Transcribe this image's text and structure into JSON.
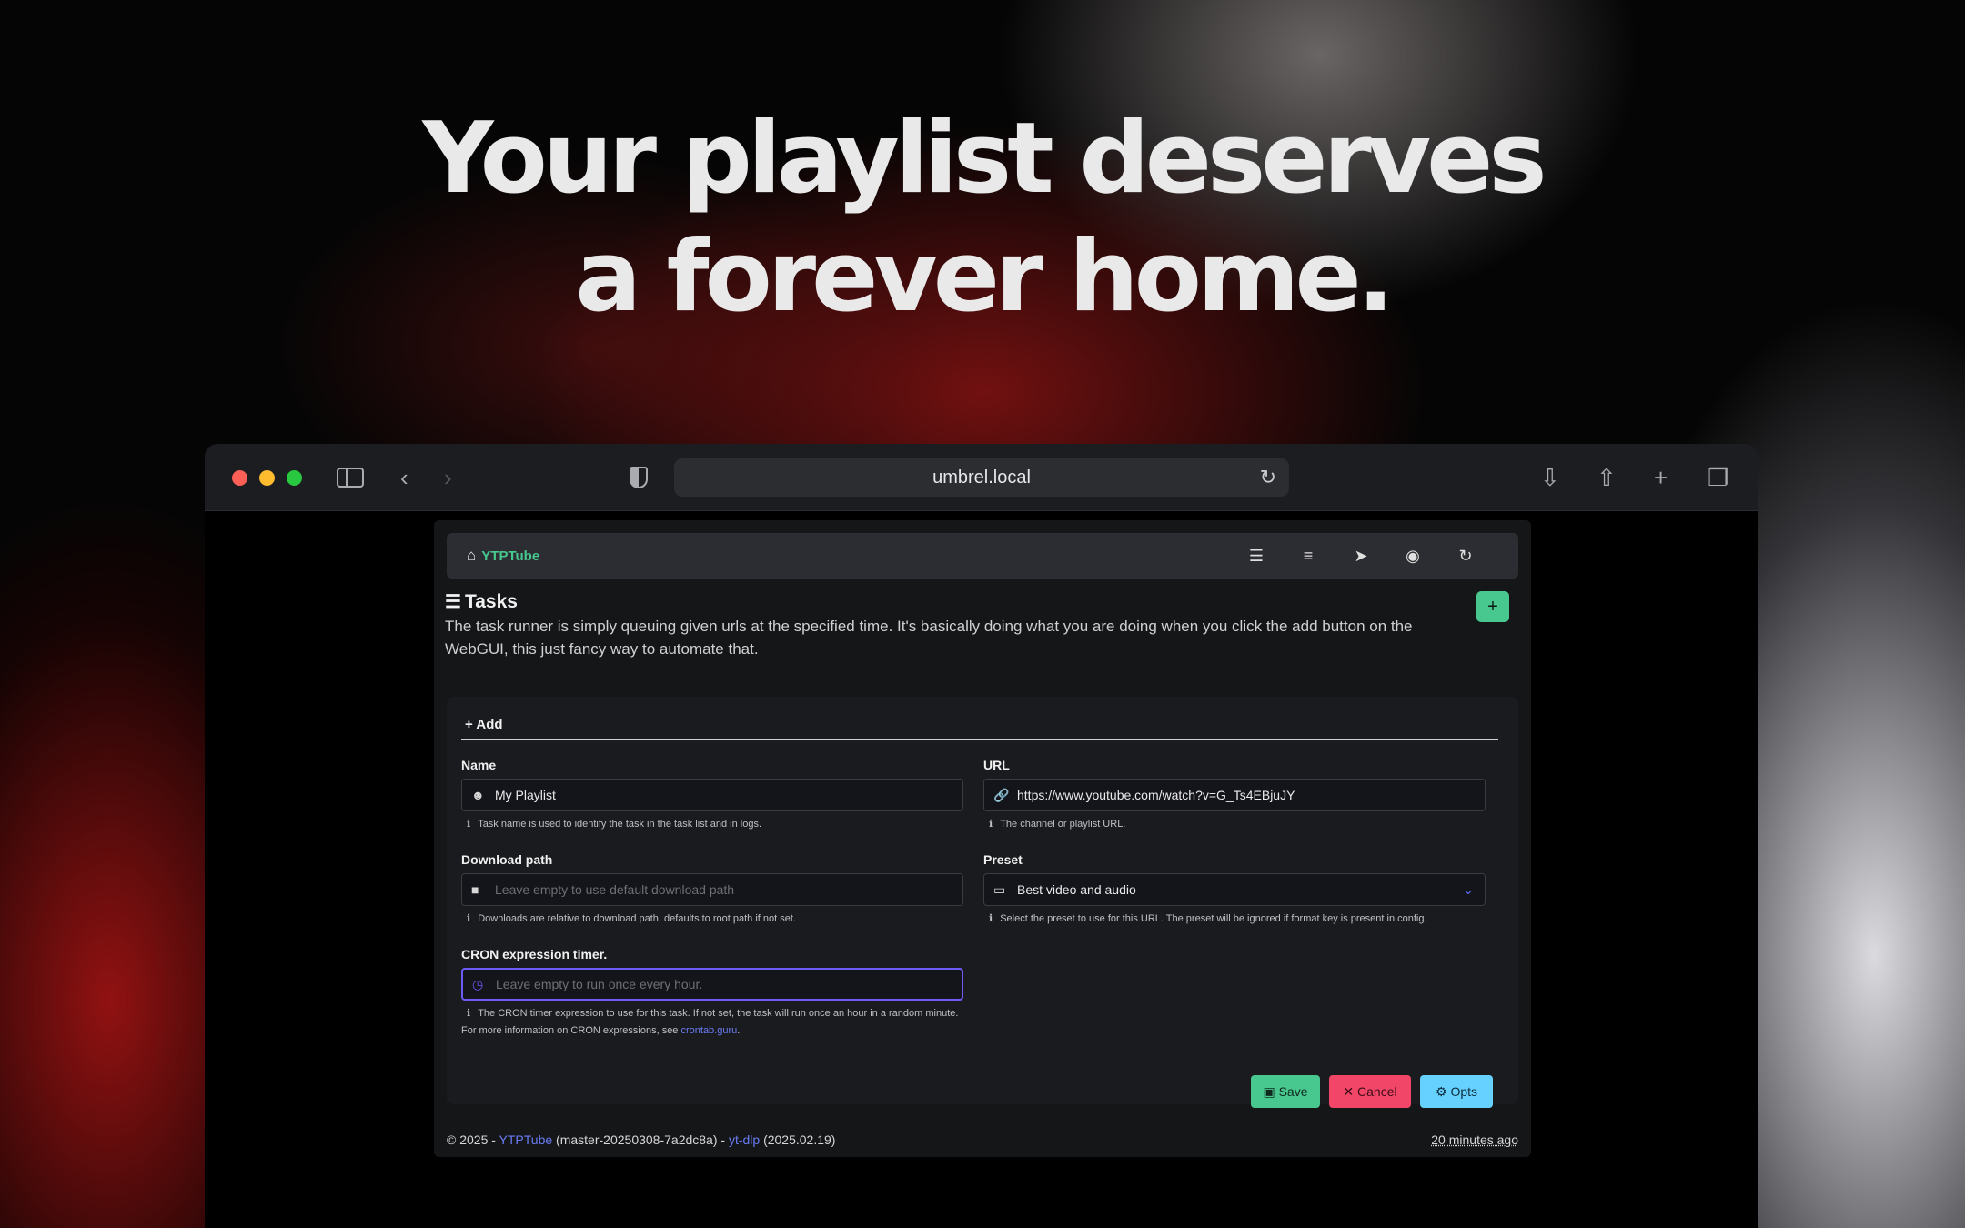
{
  "hero": {
    "line1": "Your playlist deserves",
    "line2": "a forever home."
  },
  "browser": {
    "address": "umbrel.local",
    "icons": [
      "sidebar-toggle-icon",
      "back-icon",
      "forward-icon",
      "shield-icon",
      "reload-icon",
      "download-icon",
      "share-icon",
      "new-tab-icon",
      "tabs-overview-icon"
    ]
  },
  "navbar": {
    "brand": "YTPTube",
    "icons": [
      "sliders-icon",
      "task-list-icon",
      "paper-plane-icon",
      "globe-icon",
      "refresh-icon"
    ]
  },
  "page": {
    "title": "Tasks",
    "description": "The task runner is simply queuing given urls at the specified time. It's basically doing what you are doing when you click the add button on the WebGUI, this just fancy way to automate that.",
    "add_button": "+"
  },
  "form": {
    "header": "Add",
    "name": {
      "label": "Name",
      "value": "My Playlist",
      "help": "Task name is used to identify the task in the task list and in logs."
    },
    "url": {
      "label": "URL",
      "value": "https://www.youtube.com/watch?v=G_Ts4EBjuJY",
      "help": "The channel or playlist URL."
    },
    "download_path": {
      "label": "Download path",
      "placeholder": "Leave empty to use default download path",
      "help": "Downloads are relative to download path, defaults to root path if not set."
    },
    "preset": {
      "label": "Preset",
      "value": "Best video and audio",
      "help": "Select the preset to use for this URL. The preset will be ignored if format key is present in config."
    },
    "cron": {
      "label": "CRON expression timer.",
      "placeholder": "Leave empty to run once every hour.",
      "help": "The CRON timer expression to use for this task. If not set, the task will run once an hour in a random minute.",
      "more_prefix": "For more information on CRON expressions, see ",
      "more_link": "crontab.guru",
      "more_suffix": "."
    },
    "buttons": {
      "save": "Save",
      "cancel": "Cancel",
      "opts": "Opts"
    }
  },
  "footer": {
    "copyright": "© 2025 - ",
    "app_link": "YTPTube",
    "version": " (master-20250308-7a2dc8a) - ",
    "ytdlp_link": "yt-dlp",
    "ytdlp_version": " (2025.02.19)",
    "updated": "20 minutes ago"
  }
}
